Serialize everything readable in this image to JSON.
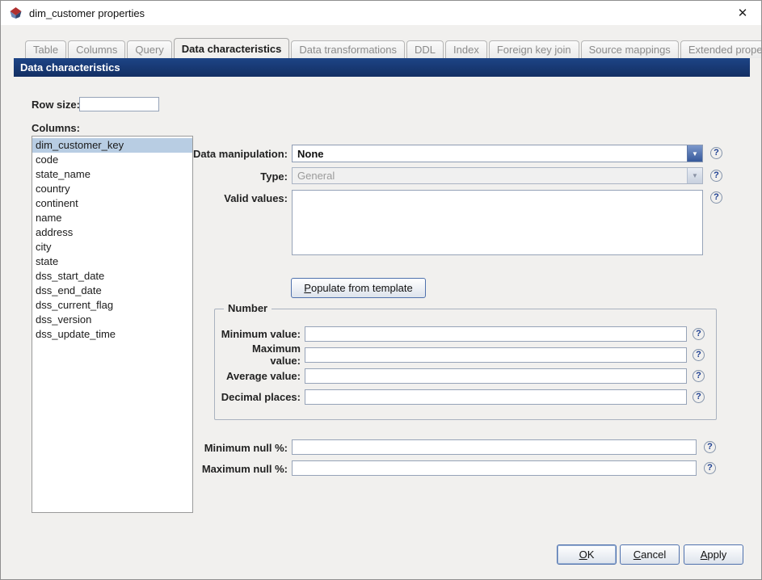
{
  "window": {
    "title": "dim_customer properties"
  },
  "icons": {
    "help": "?",
    "dropdown_arrow": "▼",
    "close": "✕"
  },
  "colors": {
    "header_bg": "#16386e",
    "selection_bg": "#b8cde3",
    "accent_blue": "#35589a"
  },
  "tabs": [
    {
      "label": "Table"
    },
    {
      "label": "Columns"
    },
    {
      "label": "Query"
    },
    {
      "label": "Data characteristics",
      "active": true
    },
    {
      "label": "Data transformations"
    },
    {
      "label": "DDL"
    },
    {
      "label": "Index"
    },
    {
      "label": "Foreign key join"
    },
    {
      "label": "Source mappings"
    },
    {
      "label": "Extended properties"
    }
  ],
  "header": {
    "title": "Data characteristics"
  },
  "form": {
    "row_size_label": "Row size:",
    "row_size_value": "",
    "columns_label": "Columns:",
    "columns": [
      {
        "label": "dim_customer_key",
        "selected": true
      },
      {
        "label": "code"
      },
      {
        "label": "state_name"
      },
      {
        "label": "country"
      },
      {
        "label": "continent"
      },
      {
        "label": "name"
      },
      {
        "label": "address"
      },
      {
        "label": "city"
      },
      {
        "label": "state"
      },
      {
        "label": "dss_start_date"
      },
      {
        "label": "dss_end_date"
      },
      {
        "label": "dss_current_flag"
      },
      {
        "label": "dss_version"
      },
      {
        "label": "dss_update_time"
      }
    ],
    "data_manipulation_label": "Data manipulation:",
    "data_manipulation_value": "None",
    "type_label": "Type:",
    "type_value": "General",
    "valid_values_label": "Valid values:",
    "valid_values_value": "",
    "populate_button": {
      "mnemonic": "P",
      "rest": "opulate from template"
    },
    "number_group": {
      "title": "Number",
      "fields": [
        {
          "label": "Minimum value:",
          "value": ""
        },
        {
          "label": "Maximum value:",
          "value": ""
        },
        {
          "label": "Average value:",
          "value": ""
        },
        {
          "label": "Decimal places:",
          "value": ""
        }
      ]
    },
    "min_null_label": "Minimum null %:",
    "min_null_value": "",
    "max_null_label": "Maximum null %:",
    "max_null_value": ""
  },
  "footer": {
    "ok": {
      "mnemonic": "O",
      "rest": "K"
    },
    "cancel": {
      "mnemonic": "C",
      "rest": "ancel"
    },
    "apply": {
      "mnemonic": "A",
      "rest": "pply"
    }
  }
}
